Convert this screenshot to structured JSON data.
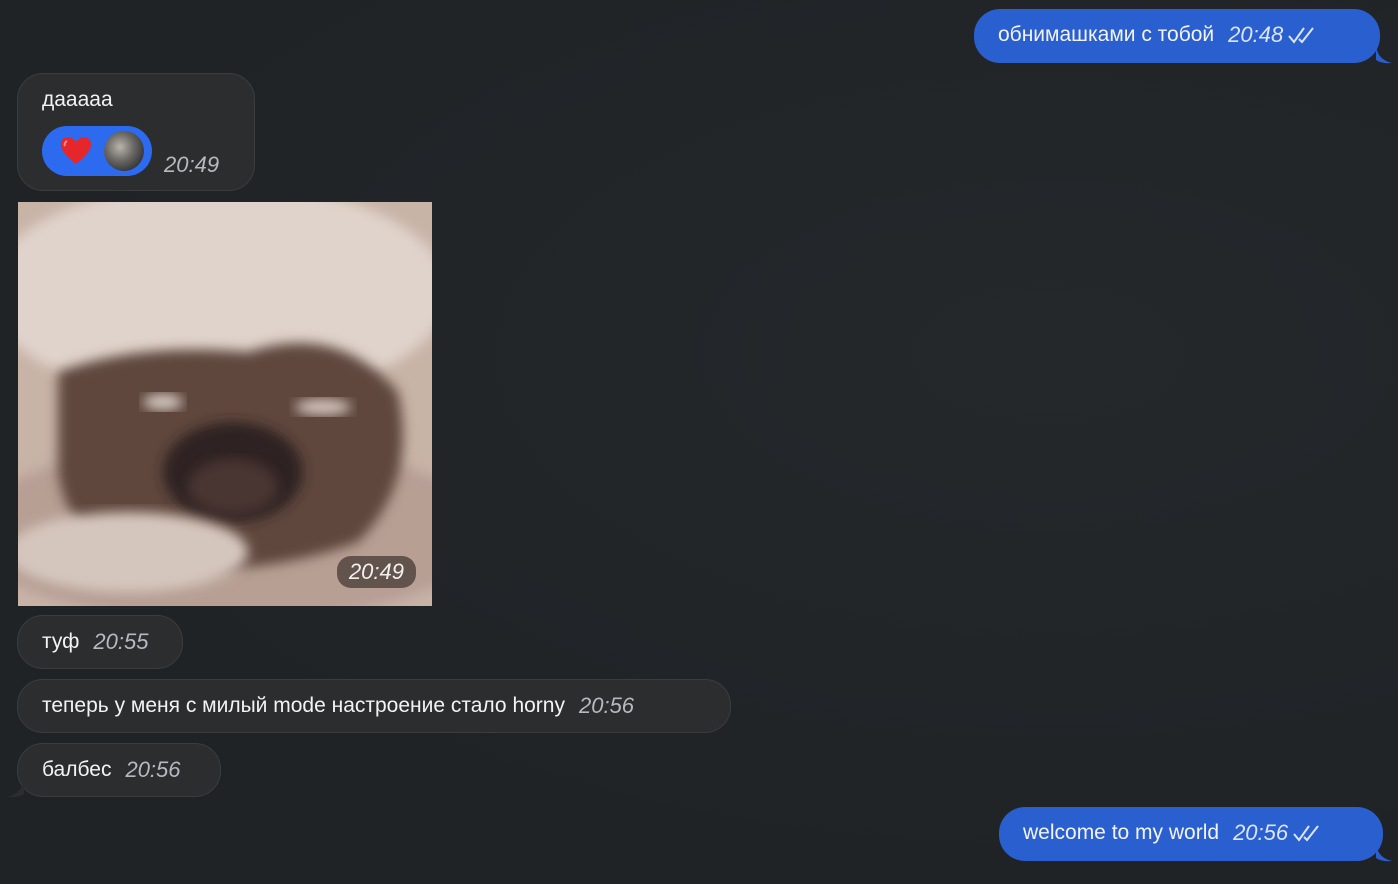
{
  "messages": [
    {
      "text": "обнимашками с тобой",
      "time": "20:48"
    },
    {
      "text": "дааааа",
      "time": "20:49"
    },
    {
      "time": "20:49"
    },
    {
      "text": "туф",
      "time": "20:55"
    },
    {
      "text": "теперь у меня с милый mode настроение стало horny",
      "time": "20:56"
    },
    {
      "text": "балбес",
      "time": "20:56"
    },
    {
      "text": "welcome to my world",
      "time": "20:56"
    }
  ],
  "reaction": {
    "emoji": "heart-icon",
    "avatar": "avatar"
  },
  "colors": {
    "background": "#212427",
    "incoming": "#2b2d2f",
    "outgoing": "#2a5fcf",
    "reaction": "#2c6bf0"
  }
}
